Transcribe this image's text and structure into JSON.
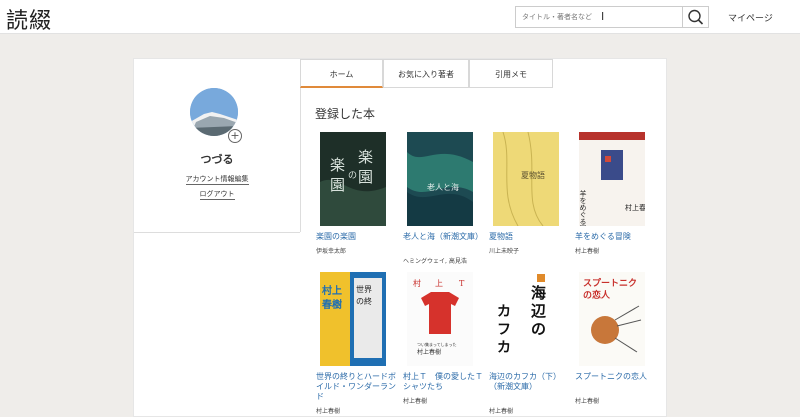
{
  "header": {
    "logo": "読綴",
    "search_placeholder": "タイトル・著者名など",
    "mypage_label": "マイページ"
  },
  "profile": {
    "username": "つづる",
    "edit_account_label": "アカウント情報編集",
    "logout_label": "ログアウト"
  },
  "tabs": [
    {
      "label": "ホーム",
      "active": true
    },
    {
      "label": "お気に入り著者",
      "active": false
    },
    {
      "label": "引用メモ",
      "active": false
    }
  ],
  "main": {
    "section_title": "登録した本",
    "books": [
      {
        "title": "楽園の楽園",
        "author": "伊坂幸太郎",
        "cover_text": "楽園の楽園"
      },
      {
        "title": "老人と海（新潮文庫）",
        "author": "ヘミングウェイ, 高見浩",
        "cover_text": "老人と海"
      },
      {
        "title": "夏物語",
        "author": "川上未映子",
        "cover_text": "夏物語"
      },
      {
        "title": "羊をめぐる冒険",
        "author": "村上春樹",
        "cover_text": "羊をめぐる冒険"
      },
      {
        "title": "世界の終りとハードボイルド・ワンダーランド",
        "author": "村上春樹",
        "cover_text": "村上春樹"
      },
      {
        "title": "村上Ｔ　僕の愛したＴシャツたち",
        "author": "村上春樹",
        "cover_text": "村上T"
      },
      {
        "title": "海辺のカフカ（下）（新潮文庫）",
        "author": "村上春樹",
        "cover_text": "海辺のカフカ"
      },
      {
        "title": "スプートニクの恋人",
        "author": "村上春樹",
        "cover_text": "スプートニクの恋人"
      }
    ]
  },
  "colors": {
    "accent": "#e08a3a",
    "link": "#2a6aa8",
    "background": "#efedea"
  }
}
